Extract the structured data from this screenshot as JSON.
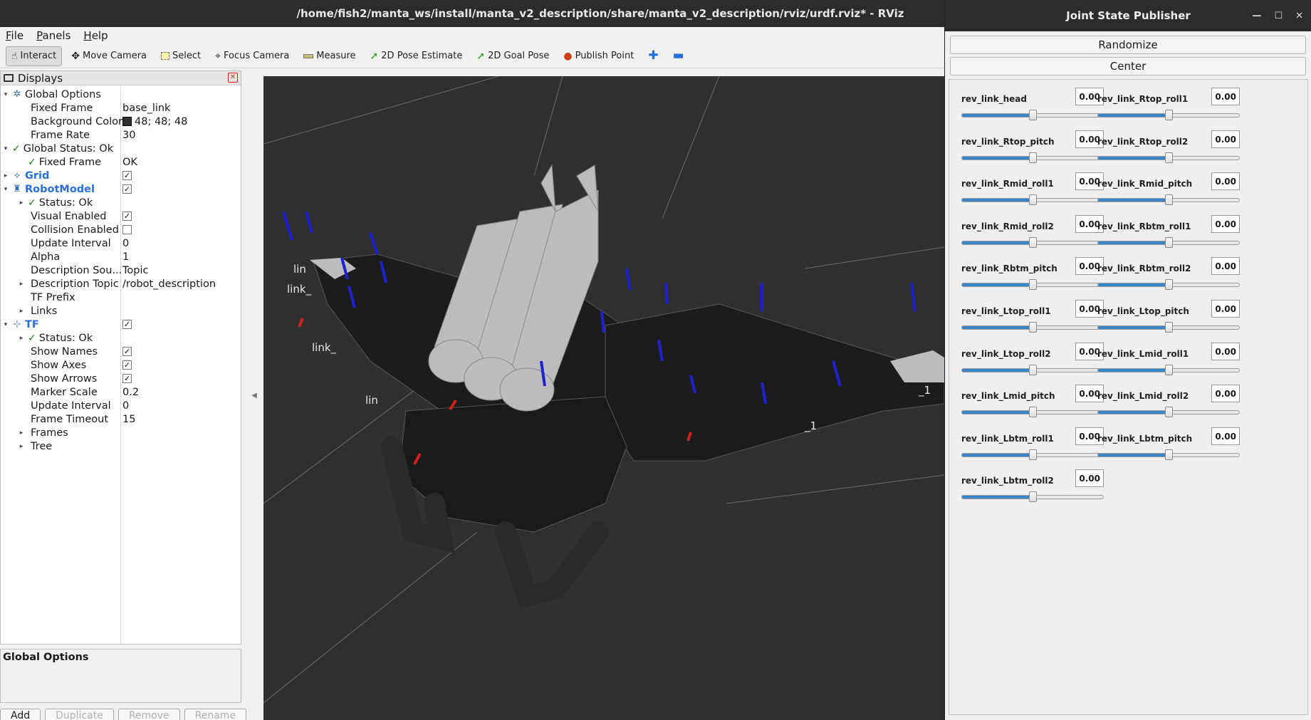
{
  "rviz": {
    "title": "/home/fish2/manta_ws/install/manta_v2_description/share/manta_v2_description/rviz/urdf.rviz* - RViz",
    "menu": [
      "File",
      "Panels",
      "Help"
    ],
    "tools": [
      {
        "label": "Interact",
        "icon": "cursor-icon"
      },
      {
        "label": "Move Camera",
        "icon": "move-camera-icon"
      },
      {
        "label": "Select",
        "icon": "select-icon"
      },
      {
        "label": "Focus Camera",
        "icon": "focus-camera-icon"
      },
      {
        "label": "Measure",
        "icon": "measure-icon"
      },
      {
        "label": "2D Pose Estimate",
        "icon": "pose-estimate-icon"
      },
      {
        "label": "2D Goal Pose",
        "icon": "goal-pose-icon"
      },
      {
        "label": "Publish Point",
        "icon": "publish-point-icon"
      }
    ],
    "displays_title": "Displays",
    "tree": [
      {
        "name": "Global Options",
        "level": 0,
        "expand": "open",
        "icon": "gear-icon"
      },
      {
        "name": "Fixed Frame",
        "level": 1,
        "value": "base_link"
      },
      {
        "name": "Background Color",
        "level": 1,
        "value": "48; 48; 48",
        "swatch": "#303030"
      },
      {
        "name": "Frame Rate",
        "level": 1,
        "value": "30"
      },
      {
        "name": "Global Status: Ok",
        "level": 0,
        "expand": "open",
        "status": "ok"
      },
      {
        "name": "Fixed Frame",
        "level": 1,
        "status": "ok",
        "value": "OK"
      },
      {
        "name": "Grid",
        "level": 0,
        "expand": "closed",
        "icon": "grid-icon",
        "bold": true,
        "checkbox": true
      },
      {
        "name": "RobotModel",
        "level": 0,
        "expand": "open",
        "icon": "robot-icon",
        "bold": true,
        "checkbox": true
      },
      {
        "name": "Status: Ok",
        "level": 1,
        "expand": "closed",
        "status": "ok"
      },
      {
        "name": "Visual Enabled",
        "level": 1,
        "checkbox": true
      },
      {
        "name": "Collision Enabled",
        "level": 1,
        "checkbox": false
      },
      {
        "name": "Update Interval",
        "level": 1,
        "value": "0"
      },
      {
        "name": "Alpha",
        "level": 1,
        "value": "1"
      },
      {
        "name": "Description Sou...",
        "level": 1,
        "value": "Topic"
      },
      {
        "name": "Description Topic",
        "level": 1,
        "expand": "closed",
        "value": "/robot_description"
      },
      {
        "name": "TF Prefix",
        "level": 1
      },
      {
        "name": "Links",
        "level": 1,
        "expand": "closed"
      },
      {
        "name": "TF",
        "level": 0,
        "expand": "open",
        "icon": "tf-icon",
        "bold": true,
        "checkbox": true
      },
      {
        "name": "Status: Ok",
        "level": 1,
        "expand": "closed",
        "status": "ok"
      },
      {
        "name": "Show Names",
        "level": 1,
        "checkbox": true
      },
      {
        "name": "Show Axes",
        "level": 1,
        "checkbox": true
      },
      {
        "name": "Show Arrows",
        "level": 1,
        "checkbox": true
      },
      {
        "name": "Marker Scale",
        "level": 1,
        "value": "0.2"
      },
      {
        "name": "Update Interval",
        "level": 1,
        "value": "0"
      },
      {
        "name": "Frame Timeout",
        "level": 1,
        "value": "15"
      },
      {
        "name": "Frames",
        "level": 1,
        "expand": "closed"
      },
      {
        "name": "Tree",
        "level": 1,
        "expand": "closed"
      }
    ],
    "description_title": "Global Options",
    "buttons": [
      "Add",
      "Duplicate",
      "Remove",
      "Rename"
    ],
    "viewport_labels": [
      "lin",
      "link_",
      "link_",
      "lin",
      "_1",
      "_1"
    ]
  },
  "jsp": {
    "title": "Joint State Publisher",
    "randomize": "Randomize",
    "center": "Center",
    "joints": [
      {
        "name": "rev_link_head",
        "value": "0.00",
        "fraction": 0.5
      },
      {
        "name": "rev_link_Rtop_roll1",
        "value": "0.00",
        "fraction": 0.5
      },
      {
        "name": "rev_link_Rtop_pitch",
        "value": "0.00",
        "fraction": 0.5
      },
      {
        "name": "rev_link_Rtop_roll2",
        "value": "0.00",
        "fraction": 0.5
      },
      {
        "name": "rev_link_Rmid_roll1",
        "value": "0.00",
        "fraction": 0.5
      },
      {
        "name": "rev_link_Rmid_pitch",
        "value": "0.00",
        "fraction": 0.5
      },
      {
        "name": "rev_link_Rmid_roll2",
        "value": "0.00",
        "fraction": 0.5
      },
      {
        "name": "rev_link_Rbtm_roll1",
        "value": "0.00",
        "fraction": 0.5
      },
      {
        "name": "rev_link_Rbtm_pitch",
        "value": "0.00",
        "fraction": 0.5
      },
      {
        "name": "rev_link_Rbtm_roll2",
        "value": "0.00",
        "fraction": 0.5
      },
      {
        "name": "rev_link_Ltop_roll1",
        "value": "0.00",
        "fraction": 0.5
      },
      {
        "name": "rev_link_Ltop_pitch",
        "value": "0.00",
        "fraction": 0.5
      },
      {
        "name": "rev_link_Ltop_roll2",
        "value": "0.00",
        "fraction": 0.5
      },
      {
        "name": "rev_link_Lmid_roll1",
        "value": "0.00",
        "fraction": 0.5
      },
      {
        "name": "rev_link_Lmid_pitch",
        "value": "0.00",
        "fraction": 0.5
      },
      {
        "name": "rev_link_Lmid_roll2",
        "value": "0.00",
        "fraction": 0.5
      },
      {
        "name": "rev_link_Lbtm_roll1",
        "value": "0.00",
        "fraction": 0.5
      },
      {
        "name": "rev_link_Lbtm_pitch",
        "value": "0.00",
        "fraction": 0.5
      },
      {
        "name": "rev_link_Lbtm_roll2",
        "value": "0.00",
        "fraction": 0.5
      }
    ]
  },
  "colors": {
    "viewport_bg": "#303030",
    "titlebar": "#2c2c2c",
    "slider_fill": "#3a86c8",
    "tree_bold": "#2a6fd6",
    "status_ok": "#1b7a1b"
  }
}
